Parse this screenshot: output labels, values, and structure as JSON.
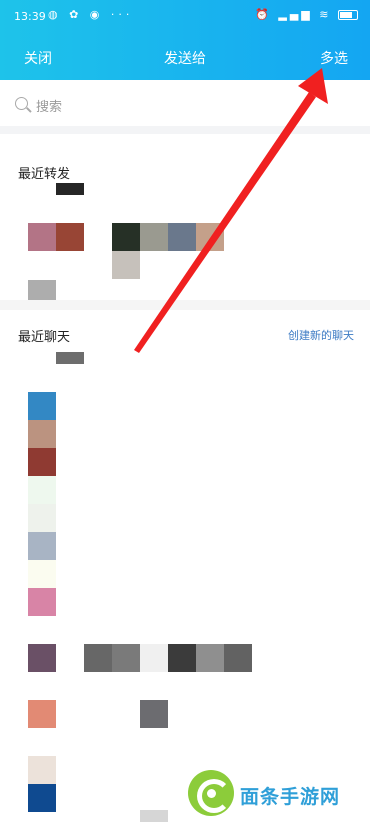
{
  "status_bar": {
    "time": "13:39",
    "left_icons": [
      "app-icon-1",
      "app-icon-2",
      "app-icon-3",
      "more-dots"
    ],
    "more": "···",
    "right_icons": [
      "alarm-icon",
      "clock-icon",
      "hd-signal-icon",
      "hd-signal-icon-2",
      "wifi-icon",
      "battery-icon"
    ],
    "battery": "86"
  },
  "nav": {
    "close_label": "关闭",
    "title": "发送给",
    "multi_select_label": "多选"
  },
  "search": {
    "placeholder": "搜索"
  },
  "recent_forward": {
    "title": "最近转发"
  },
  "recent_chats": {
    "title": "最近聊天",
    "create_chat_label": "创建新的聊天"
  },
  "watermark": {
    "text": "面条手游网"
  },
  "colors": {
    "header_start": "#1ec3ea",
    "header_end": "#14a6f2",
    "arrow": "#f02020",
    "link": "#3c7bc4"
  }
}
